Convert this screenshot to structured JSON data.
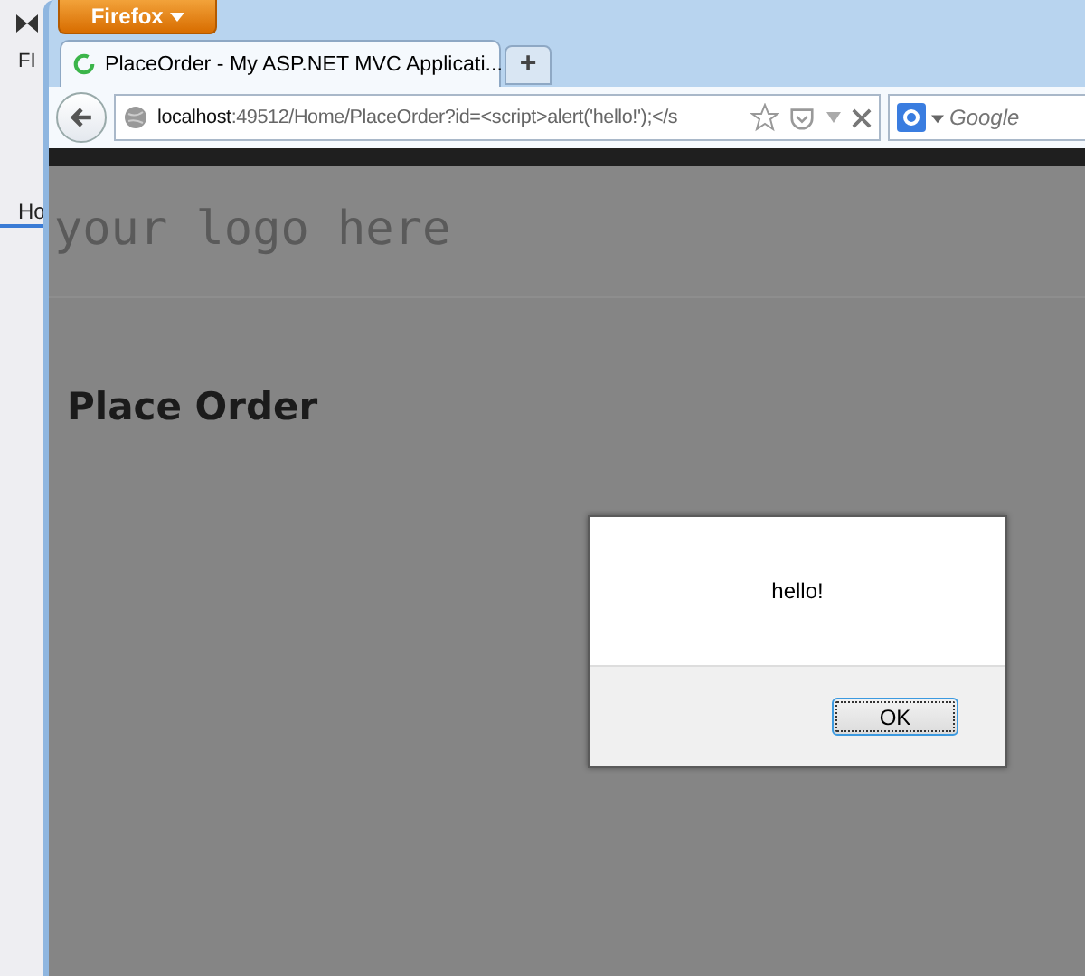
{
  "background_app": {
    "menu_text": "FI",
    "tab_text": "Ho"
  },
  "browser": {
    "menu_button": "Firefox",
    "tabs": [
      {
        "title": "PlaceOrder - My ASP.NET MVC Applicati...",
        "selected": true
      }
    ],
    "new_tab_button": "+",
    "address": {
      "host": "localhost",
      "rest": ":49512/Home/PlaceOrder?id=<script>alert('hello!');</s"
    },
    "search": {
      "placeholder": "Google"
    }
  },
  "page": {
    "logo": "your logo here",
    "heading": "Place Order"
  },
  "dialog": {
    "message": "hello!",
    "buttons": [
      "OK"
    ]
  }
}
